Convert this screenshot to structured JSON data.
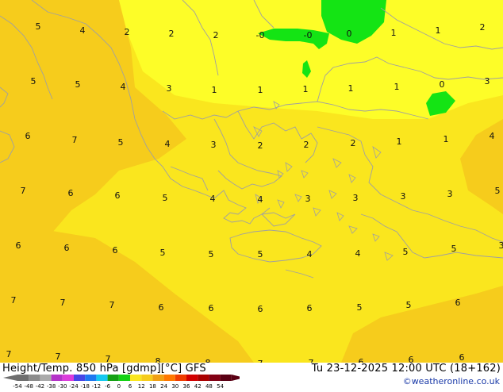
{
  "map": {
    "region": "Greece / Aegean Sea",
    "variable": "Height/Temp. 850 hPa",
    "colors": {
      "deep_yellow": "#f6cc1c",
      "yellow": "#fae61e",
      "bright_yellow": "#fdfd28",
      "green": "#14e414",
      "coast": "#a0a0a0"
    },
    "labels": [
      {
        "v": "5"
      },
      {
        "v": "4"
      },
      {
        "v": "2"
      },
      {
        "v": "2"
      },
      {
        "v": "2"
      },
      {
        "v": "-0"
      },
      {
        "v": "-0"
      },
      {
        "v": "0"
      },
      {
        "v": "1"
      },
      {
        "v": "1"
      },
      {
        "v": "2"
      },
      {
        "v": "5"
      },
      {
        "v": "5"
      },
      {
        "v": "4"
      },
      {
        "v": "3"
      },
      {
        "v": "1"
      },
      {
        "v": "1"
      },
      {
        "v": "1"
      },
      {
        "v": "1"
      },
      {
        "v": "1"
      },
      {
        "v": "0"
      },
      {
        "v": "3"
      },
      {
        "v": "6"
      },
      {
        "v": "7"
      },
      {
        "v": "5"
      },
      {
        "v": "4"
      },
      {
        "v": "3"
      },
      {
        "v": "2"
      },
      {
        "v": "2"
      },
      {
        "v": "2"
      },
      {
        "v": "1"
      },
      {
        "v": "1"
      },
      {
        "v": "4"
      },
      {
        "v": "7"
      },
      {
        "v": "6"
      },
      {
        "v": "6"
      },
      {
        "v": "5"
      },
      {
        "v": "4"
      },
      {
        "v": "4"
      },
      {
        "v": "3"
      },
      {
        "v": "3"
      },
      {
        "v": "3"
      },
      {
        "v": "3"
      },
      {
        "v": "5"
      },
      {
        "v": "6"
      },
      {
        "v": "6"
      },
      {
        "v": "6"
      },
      {
        "v": "5"
      },
      {
        "v": "5"
      },
      {
        "v": "5"
      },
      {
        "v": "4"
      },
      {
        "v": "4"
      },
      {
        "v": "5"
      },
      {
        "v": "5"
      },
      {
        "v": "3"
      },
      {
        "v": "7"
      },
      {
        "v": "7"
      },
      {
        "v": "7"
      },
      {
        "v": "6"
      },
      {
        "v": "6"
      },
      {
        "v": "6"
      },
      {
        "v": "6"
      },
      {
        "v": "5"
      },
      {
        "v": "5"
      },
      {
        "v": "6"
      },
      {
        "v": "7"
      },
      {
        "v": "7"
      },
      {
        "v": "7"
      },
      {
        "v": "8"
      },
      {
        "v": "8"
      },
      {
        "v": "7"
      },
      {
        "v": "7"
      },
      {
        "v": "6"
      },
      {
        "v": "6"
      },
      {
        "v": "6"
      }
    ]
  },
  "footer": {
    "title": "Height/Temp. 850 hPa [gdmp][°C] GFS",
    "datetime": "Tu 23-12-2025 12:00 UTC (18+162)",
    "credit": "©weatheronline.co.uk",
    "scale_ticks": [
      "-54",
      "-48",
      "-42",
      "-38",
      "-30",
      "-24",
      "-18",
      "-12",
      "-6",
      "0",
      "6",
      "12",
      "18",
      "24",
      "30",
      "36",
      "42",
      "48",
      "54"
    ],
    "scale_colors": [
      "#6e6e6e",
      "#8c8c8c",
      "#aaaaaa",
      "#b432c8",
      "#dc3cdc",
      "#4646e6",
      "#1e78f0",
      "#14c8f0",
      "#14a014",
      "#14d214",
      "#fae61e",
      "#f6cc1c",
      "#f0a014",
      "#ff7800",
      "#f03c00",
      "#d20000",
      "#aa0000",
      "#820014",
      "#5a0014"
    ]
  }
}
